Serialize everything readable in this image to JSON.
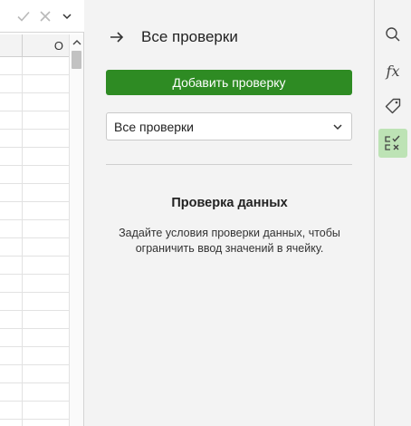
{
  "sheet": {
    "column_header_label": "O"
  },
  "panel": {
    "title": "Все проверки",
    "add_button_label": "Добавить проверку",
    "filter_select_value": "Все проверки",
    "empty_state_title": "Проверка данных",
    "empty_state_description": "Задайте условия проверки данных, чтобы ограничить ввод значений в ячейку."
  },
  "rail": {
    "fx_label": "fx",
    "buttons": [
      "search-icon",
      "function-icon",
      "tag-icon",
      "data-validation-icon"
    ]
  },
  "colors": {
    "accent_green": "#2e8b23",
    "active_tool_bg": "#bde3b5",
    "panel_bg": "#f3f3f3"
  }
}
